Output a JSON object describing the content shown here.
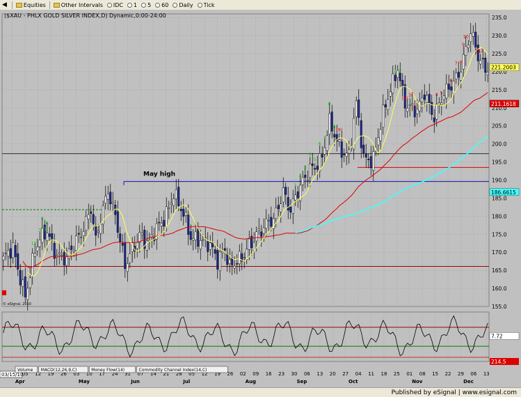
{
  "toolbar": {
    "items": [
      {
        "id": "equities",
        "label": "Equities",
        "kind": "folder"
      },
      {
        "id": "other-intervals",
        "label": "Other Intervals",
        "kind": "folder"
      },
      {
        "id": "idc",
        "label": "IDC",
        "kind": "radio"
      },
      {
        "id": "1",
        "label": "1",
        "kind": "radio"
      },
      {
        "id": "5",
        "label": "5",
        "kind": "radio"
      },
      {
        "id": "60",
        "label": "60",
        "kind": "radio"
      },
      {
        "id": "daily",
        "label": "Daily",
        "kind": "radio"
      },
      {
        "id": "tick",
        "label": "Tick",
        "kind": "radio"
      }
    ]
  },
  "status_text": "Published by eSignal  |  www.esignal.com",
  "chart_data": {
    "type": "candlestick",
    "title": "($XAU - PHLX GOLD SILVER INDEX,D) Dynamic,0:00-24:00",
    "copyright": "© eSignal, 2010",
    "start_date": "03/15/10",
    "y_range": [
      155,
      236
    ],
    "y_ticks": [
      155,
      160,
      165,
      170,
      175,
      180,
      185,
      190,
      195,
      200,
      205,
      210,
      215,
      220,
      225,
      230,
      235
    ],
    "x_day_ticks": [
      "29",
      "05",
      "12",
      "19",
      "26",
      "03",
      "10",
      "17",
      "24",
      "31",
      "07",
      "14",
      "21",
      "28",
      "05",
      "12",
      "19",
      "26",
      "02",
      "09",
      "16",
      "23",
      "30",
      "06",
      "13",
      "20",
      "27",
      "04",
      "11",
      "18",
      "25",
      "01",
      "08",
      "15",
      "22",
      "29",
      "06",
      "13"
    ],
    "x_month_labels": [
      "Apr",
      "May",
      "Jun",
      "Jul",
      "Aug",
      "Sep",
      "Oct",
      "Nov",
      "Dec"
    ],
    "price_labels": [
      {
        "text": "221.2003",
        "color": "#ffff60",
        "value": 221.2
      },
      {
        "text": "211.1618",
        "color": "#dd0000",
        "value": 211.16
      },
      {
        "text": "186.6615",
        "color": "#40ffff",
        "value": 186.66
      }
    ],
    "annotations": [
      {
        "text": "May high",
        "value": 189.6
      }
    ],
    "horizontal_lines": [
      {
        "value": 189.6,
        "color": "#1010b0",
        "style": "solid"
      },
      {
        "value": 166.1,
        "color": "#a00000",
        "style": "solid"
      },
      {
        "value": 197.3,
        "color": "#303030",
        "style": "solid"
      },
      {
        "value": 193.5,
        "color": "#dd0000",
        "style": "solid"
      },
      {
        "value": 181.8,
        "color": "#008000",
        "style": "dashed"
      }
    ],
    "seq_labels": [
      {
        "text": "1",
        "color": "#00cc00",
        "i": 12,
        "above": true
      },
      {
        "text": "2",
        "color": "#00cc00",
        "i": 13,
        "above": true
      },
      {
        "text": "3",
        "color": "#00cc00",
        "i": 15,
        "above": true
      },
      {
        "text": "4",
        "color": "#00cc00",
        "i": 16,
        "above": true
      },
      {
        "text": "5",
        "color": "#00cc00",
        "i": 17,
        "above": true
      },
      {
        "text": "6",
        "color": "#00cc00",
        "i": 18,
        "above": true
      },
      {
        "text": "1",
        "color": "#00cc00",
        "i": 120,
        "above": true
      },
      {
        "text": "2",
        "color": "#00cc00",
        "i": 122,
        "above": true
      },
      {
        "text": "3",
        "color": "#00cc00",
        "i": 124,
        "above": true
      },
      {
        "text": "4",
        "color": "#00cc00",
        "i": 126,
        "above": true
      },
      {
        "text": "5",
        "color": "#00cc00",
        "i": 128,
        "above": true
      },
      {
        "text": "6",
        "color": "#00cc00",
        "i": 130,
        "above": true
      },
      {
        "text": "7",
        "color": "#00cc00",
        "i": 132,
        "above": true
      },
      {
        "text": "8",
        "color": "#00cc00",
        "i": 134,
        "above": true
      },
      {
        "text": "9",
        "color": "#00cc00",
        "i": 136,
        "above": true
      },
      {
        "text": "(9)",
        "color": "#dd0000",
        "i": 138,
        "above": true
      },
      {
        "text": "1",
        "color": "#00cc00",
        "i": 161,
        "above": true
      },
      {
        "text": "2",
        "color": "#00cc00",
        "i": 163,
        "above": true
      },
      {
        "text": "(9)",
        "color": "#dd0000",
        "i": 165,
        "above": true
      },
      {
        "text": "1",
        "color": "#dd0000",
        "i": 167,
        "above": true
      },
      {
        "text": "2",
        "color": "#dd0000",
        "i": 168,
        "above": true
      },
      {
        "text": "3",
        "color": "#dd0000",
        "i": 169,
        "above": true
      },
      {
        "text": "4",
        "color": "#dd0000",
        "i": 178,
        "above": true
      },
      {
        "text": "5",
        "color": "#dd0000",
        "i": 180,
        "above": true
      },
      {
        "text": "6",
        "color": "#dd0000",
        "i": 184,
        "above": true
      },
      {
        "text": "7",
        "color": "#dd0000",
        "i": 186,
        "above": true
      },
      {
        "text": "8",
        "color": "#dd0000",
        "i": 188,
        "above": true
      },
      {
        "text": "9",
        "color": "#dd0000",
        "i": 189,
        "above": true
      },
      {
        "text": "10",
        "color": "#dd0000",
        "i": 190,
        "above": true
      },
      {
        "text": "11",
        "color": "#dd0000",
        "i": 195,
        "above": true
      },
      {
        "text": "12",
        "color": "#dd0000",
        "i": 196,
        "above": true
      }
    ],
    "ohlc_keypoints": [
      [
        0,
        168
      ],
      [
        4,
        170
      ],
      [
        9,
        159
      ],
      [
        13,
        170
      ],
      [
        18,
        176
      ],
      [
        22,
        170
      ],
      [
        26,
        167
      ],
      [
        31,
        175
      ],
      [
        36,
        182
      ],
      [
        38,
        172
      ],
      [
        43,
        188
      ],
      [
        46,
        181
      ],
      [
        50,
        165
      ],
      [
        56,
        176
      ],
      [
        60,
        172
      ],
      [
        65,
        178
      ],
      [
        70,
        187
      ],
      [
        72,
        183
      ],
      [
        77,
        174
      ],
      [
        80,
        175
      ],
      [
        84,
        172
      ],
      [
        88,
        167
      ],
      [
        91,
        172
      ],
      [
        93,
        167
      ],
      [
        98,
        167
      ],
      [
        101,
        172
      ],
      [
        104,
        176
      ],
      [
        111,
        178
      ],
      [
        115,
        188
      ],
      [
        118,
        182
      ],
      [
        122,
        187
      ],
      [
        126,
        194
      ],
      [
        131,
        196
      ],
      [
        134,
        205
      ],
      [
        138,
        200
      ],
      [
        142,
        197
      ],
      [
        145,
        210
      ],
      [
        148,
        196
      ],
      [
        152,
        197
      ],
      [
        155,
        205
      ],
      [
        158,
        212
      ],
      [
        162,
        222
      ],
      [
        164,
        215
      ],
      [
        166,
        210
      ],
      [
        170,
        208
      ],
      [
        173,
        215
      ],
      [
        177,
        208
      ],
      [
        183,
        215
      ],
      [
        188,
        222
      ],
      [
        192,
        230
      ],
      [
        195,
        224
      ],
      [
        198,
        222
      ]
    ],
    "bars": 200,
    "ma_fast": {
      "color": "#ffff60",
      "name": "ma-fast"
    },
    "ma_mid": {
      "color": "#dd0000",
      "name": "ma-mid"
    },
    "ma_slow": {
      "color": "#40ffff",
      "name": "ma-slow"
    },
    "cci": {
      "name": "Commodity Channel Index (14,C)",
      "current_label": "7.72",
      "extra_label": "214.5",
      "levels": [
        100,
        -100
      ]
    },
    "indicator_tabs": [
      "Volume",
      "MACD(12,26,9,C)",
      "Money Flow(14)",
      "Commodity Channel Index(14,C)"
    ]
  }
}
